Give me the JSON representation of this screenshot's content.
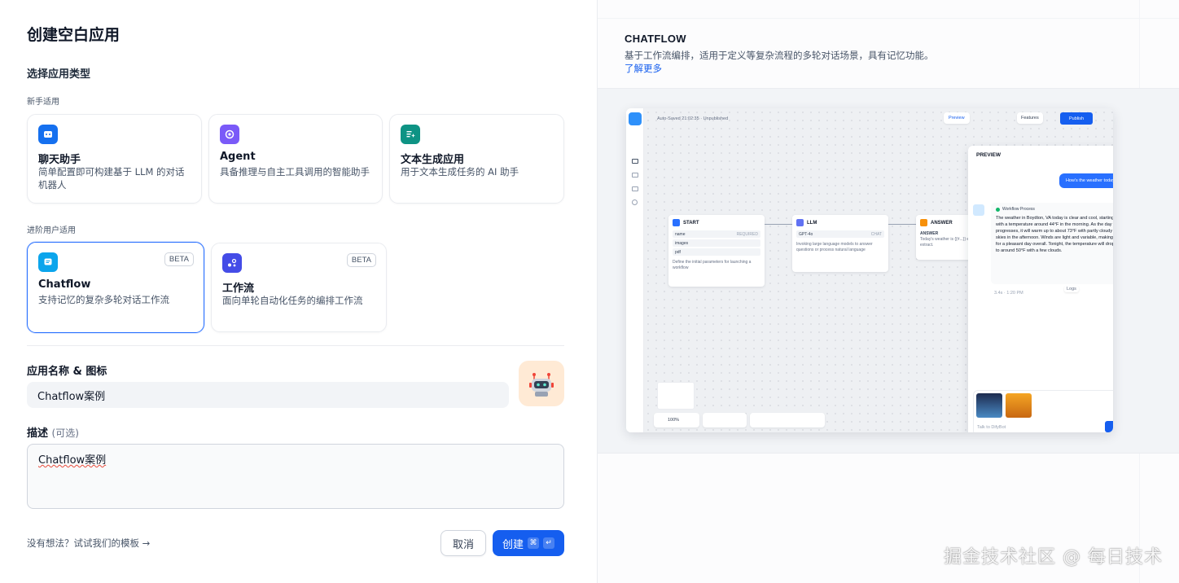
{
  "dialog": {
    "title": "创建空白应用",
    "choose_type_label": "选择应用类型",
    "beginner_label": "新手适用",
    "advanced_label": "进阶用户适用",
    "app_types": [
      {
        "title": "聊天助手",
        "desc": "简单配置即可构建基于 LLM 的对话机器人",
        "icon": "chat-bot-icon",
        "color": "#1570ef"
      },
      {
        "title": "Agent",
        "desc": "具备推理与自主工具调用的智能助手",
        "icon": "agent-icon",
        "color": "#7a5af8"
      },
      {
        "title": "文本生成应用",
        "desc": "用于文本生成任务的 AI 助手",
        "icon": "text-generation-icon",
        "color": "#0e9384"
      },
      {
        "title": "Chatflow",
        "desc": "支持记忆的复杂多轮对话工作流",
        "icon": "chatflow-icon",
        "color": "#0ba5ec",
        "badge": "BETA",
        "selected": true
      },
      {
        "title": "工作流",
        "desc": "面向单轮自动化任务的编排工作流",
        "icon": "workflow-icon",
        "color": "#444ce7",
        "badge": "BETA"
      }
    ],
    "name_icon_label": "应用名称 & 图标",
    "name_value": "Chatflow案例",
    "desc_label": "描述",
    "desc_optional": "(可选)",
    "desc_value": "Chatflow案例",
    "template_link": "没有想法？试试我们的模板 →",
    "cancel_label": "取消",
    "create_label": "创建",
    "create_shortcut_1": "⌘",
    "create_shortcut_2": "↵"
  },
  "preview": {
    "title": "CHATFLOW",
    "desc": "基于工作流编排，适用于定义等复杂流程的多轮对话场景，具有记忆功能。",
    "learn_more": "了解更多",
    "mock": {
      "autosaved": "Auto-Saved 21:02:35 · Unpublished",
      "preview_btn": "Preview",
      "features_btn": "Features",
      "publish_btn": "Publish",
      "start_node": "START",
      "start_vars": [
        "name",
        "images",
        "pdf"
      ],
      "required_tag": "REQUIRED",
      "start_desc": "Define the initial parameters for launching a workflow",
      "llm_node": "LLM",
      "llm_model": "GPT-4o",
      "llm_chat_tag": "CHAT",
      "llm_desc": "Invoking large language models to answer questions or process natural language",
      "answer_node": "ANSWER",
      "answer_label": "ANSWER",
      "answer_text": "Today's weather is {{#...}} entities to extract.",
      "preview_panel_title": "PREVIEW",
      "user_msg": "How's the weather today",
      "workflow_process": "Workflow Process",
      "bot_msg": "The weather in Boydton, VA today is clear and cool, starting with a temperature around 44°F in the morning. As the day progresses, it will warm up to about 73°F with partly cloudy skies in the afternoon. Winds are light and variable, making for a pleasant day overall. Tonight, the temperature will drop to around 50°F with a few clouds.",
      "bot_meta": "3.4s · 1:20 PM",
      "logs_label": "Logs",
      "input_placeholder": "Talk to DifyBot",
      "zoom": "100%"
    }
  },
  "watermark": "掘金技术社区 @ 每日技术"
}
